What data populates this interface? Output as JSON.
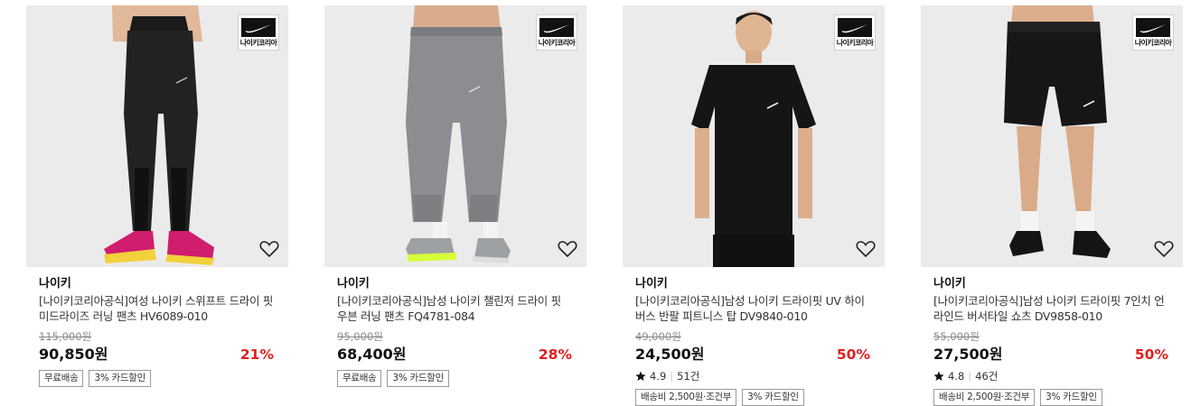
{
  "products": [
    {
      "badge": "나이키코리아",
      "brand": "나이키",
      "title": "[나이키코리아공식]여성 나이키 스위프트 드라이 핏 미드라이즈 러닝 팬츠 HV6089-010",
      "original_price": "115,000원",
      "price": "90,850원",
      "discount": "21%",
      "rating": null,
      "review_count": null,
      "tags": [
        "무료배송",
        "3% 카드할인"
      ]
    },
    {
      "badge": "나이키코리아",
      "brand": "나이키",
      "title": "[나이키코리아공식]남성 나이키 챌린저 드라이 핏 우븐 러닝 팬츠 FQ4781-084",
      "original_price": "95,000원",
      "price": "68,400원",
      "discount": "28%",
      "rating": null,
      "review_count": null,
      "tags": [
        "무료배송",
        "3% 카드할인"
      ]
    },
    {
      "badge": "나이키코리아",
      "brand": "나이키",
      "title": "[나이키코리아공식]남성 나이키 드라이핏 UV 하이버스 반팔 피트니스 탑 DV9840-010",
      "original_price": "49,000원",
      "price": "24,500원",
      "discount": "50%",
      "rating": "4.9",
      "review_count": "51건",
      "tags": [
        "배송비 2,500원·조건부",
        "3% 카드할인"
      ]
    },
    {
      "badge": "나이키코리아",
      "brand": "나이키",
      "title": "[나이키코리아공식]남성 나이키 드라이핏 7인치 언라인드 버서타일 쇼츠 DV9858-010",
      "original_price": "55,000원",
      "price": "27,500원",
      "discount": "50%",
      "rating": "4.8",
      "review_count": "46건",
      "tags": [
        "배송비 2,500원·조건부",
        "3% 카드할인"
      ]
    }
  ],
  "icons": {
    "wishlist": "heart-outline-icon",
    "rating": "star-icon",
    "brand_logo": "nike-swoosh-icon"
  },
  "colors": {
    "discount": "#e02020",
    "thumb_background": "#ebebeb"
  }
}
